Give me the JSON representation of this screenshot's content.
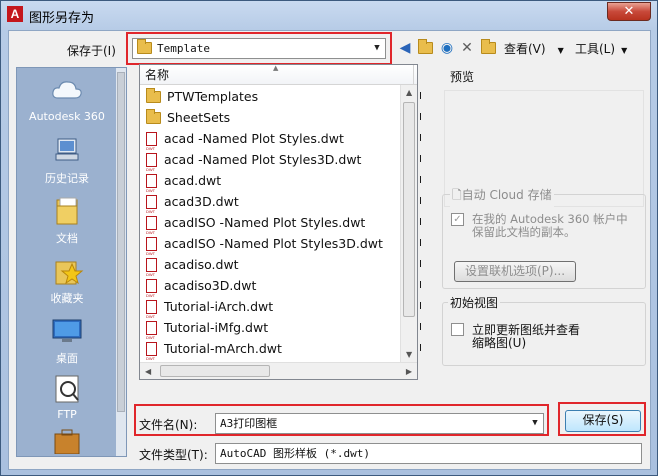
{
  "window": {
    "title": "图形另存为",
    "app_icon_letter": "A",
    "close_label": "✕"
  },
  "toolbar": {
    "save_in_label": "保存于(I)",
    "save_in_value": "Template",
    "views_label": "查看(V)",
    "tools_label": "工具(L)"
  },
  "places": [
    {
      "label": "Autodesk 360",
      "icon": "cloud-icon"
    },
    {
      "label": "历史记录",
      "icon": "history-icon"
    },
    {
      "label": "文档",
      "icon": "documents-icon"
    },
    {
      "label": "收藏夹",
      "icon": "favorites-icon"
    },
    {
      "label": "桌面",
      "icon": "desktop-icon"
    },
    {
      "label": "FTP",
      "icon": "ftp-icon"
    }
  ],
  "filelist": {
    "column_name": "名称",
    "column2_fragment": "I",
    "items": [
      {
        "name": "PTWTemplates",
        "type": "folder"
      },
      {
        "name": "SheetSets",
        "type": "folder"
      },
      {
        "name": "acad -Named Plot Styles.dwt",
        "type": "dwt"
      },
      {
        "name": "acad -Named Plot Styles3D.dwt",
        "type": "dwt"
      },
      {
        "name": "acad.dwt",
        "type": "dwt"
      },
      {
        "name": "acad3D.dwt",
        "type": "dwt"
      },
      {
        "name": "acadISO -Named Plot Styles.dwt",
        "type": "dwt"
      },
      {
        "name": "acadISO -Named Plot Styles3D.dwt",
        "type": "dwt"
      },
      {
        "name": "acadiso.dwt",
        "type": "dwt"
      },
      {
        "name": "acadiso3D.dwt",
        "type": "dwt"
      },
      {
        "name": "Tutorial-iArch.dwt",
        "type": "dwt"
      },
      {
        "name": "Tutorial-iMfg.dwt",
        "type": "dwt"
      },
      {
        "name": "Tutorial-mArch.dwt",
        "type": "dwt"
      }
    ]
  },
  "preview": {
    "title": "预览"
  },
  "cloud": {
    "title": "自动 Cloud 存储",
    "checkbox_label_line1": "在我的 Autodesk 360 帐户中",
    "checkbox_label_line2": "保留此文档的副本。",
    "options_button": "设置联机选项(P)..."
  },
  "initial_view": {
    "title": "初始视图",
    "checkbox_label_line1": "立即更新图纸并查看",
    "checkbox_label_line2": "缩略图(U)"
  },
  "filename": {
    "label": "文件名(N):",
    "value": "A3打印图框"
  },
  "filetype": {
    "label": "文件类型(T):",
    "value": "AutoCAD 图形样板 (*.dwt)"
  },
  "save_button": "保存(S)",
  "colors": {
    "highlight_box": "#e0262b",
    "title_bar": "#b6cbe6",
    "places_bg": "#9bb1cf"
  }
}
